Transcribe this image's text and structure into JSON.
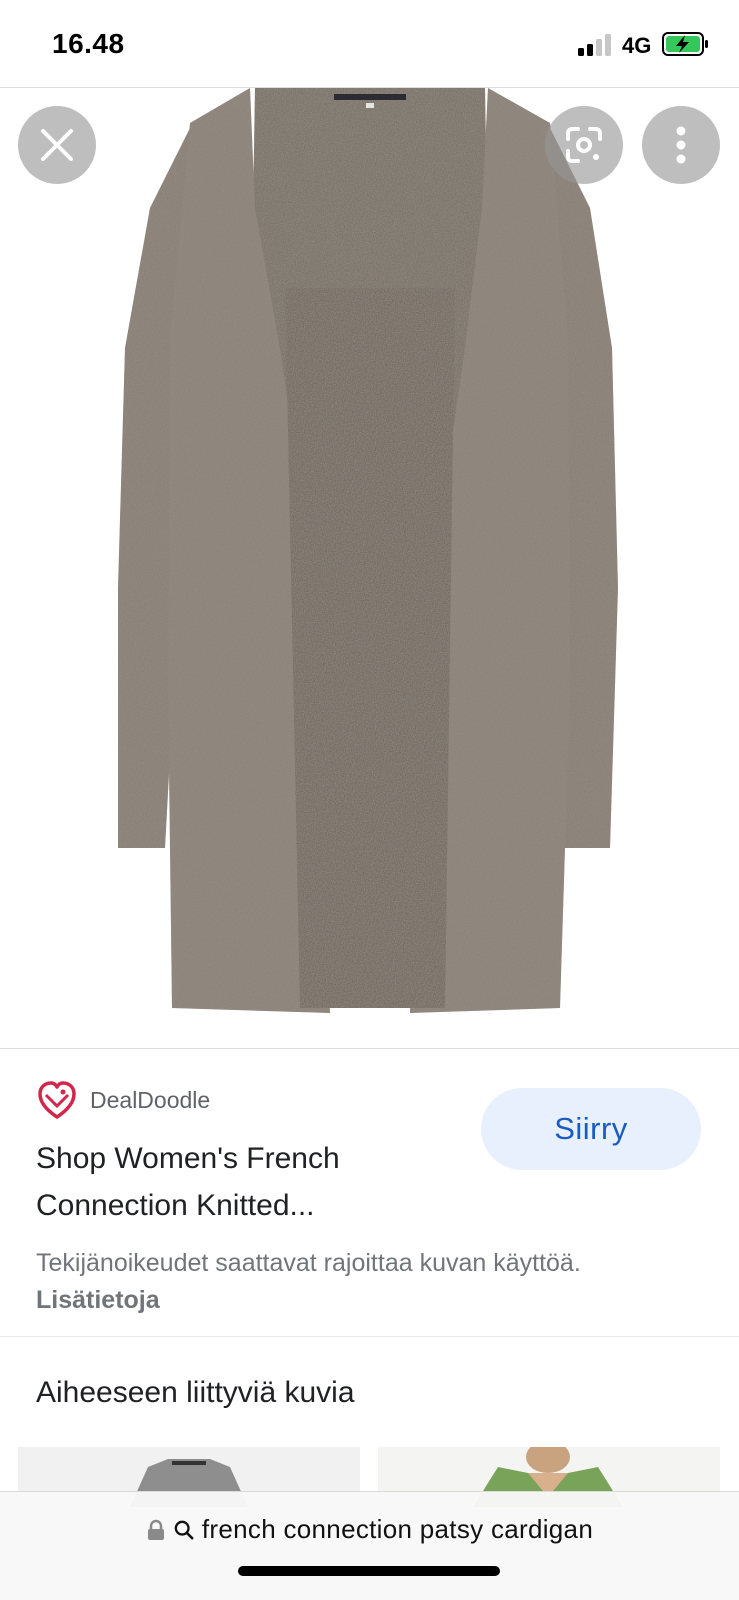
{
  "status_bar": {
    "time": "16.48",
    "network": "4G"
  },
  "image_viewer": {
    "image_description_icon": "cardigan-image",
    "controls": {
      "close_icon": "close-icon",
      "lens_icon": "google-lens-icon",
      "more_icon": "more-vert-icon"
    }
  },
  "result": {
    "source_name": "DealDoodle",
    "title_line1": "Shop Women's French",
    "title_line2": "Connection Knitted...",
    "visit_label": "Siirry",
    "copyright_text": "Tekijänoikeudet saattavat rajoittaa kuvan käyttöä.",
    "copyright_link": "Lisätietoja"
  },
  "related": {
    "heading": "Aiheeseen liittyviä kuvia"
  },
  "url_bar": {
    "query": "french connection patsy cardigan"
  },
  "colors": {
    "accent_blue": "#1a5bc2",
    "button_bg": "#e8f0fe",
    "source_logo": "#d4264a",
    "battery_green": "#34c759"
  }
}
